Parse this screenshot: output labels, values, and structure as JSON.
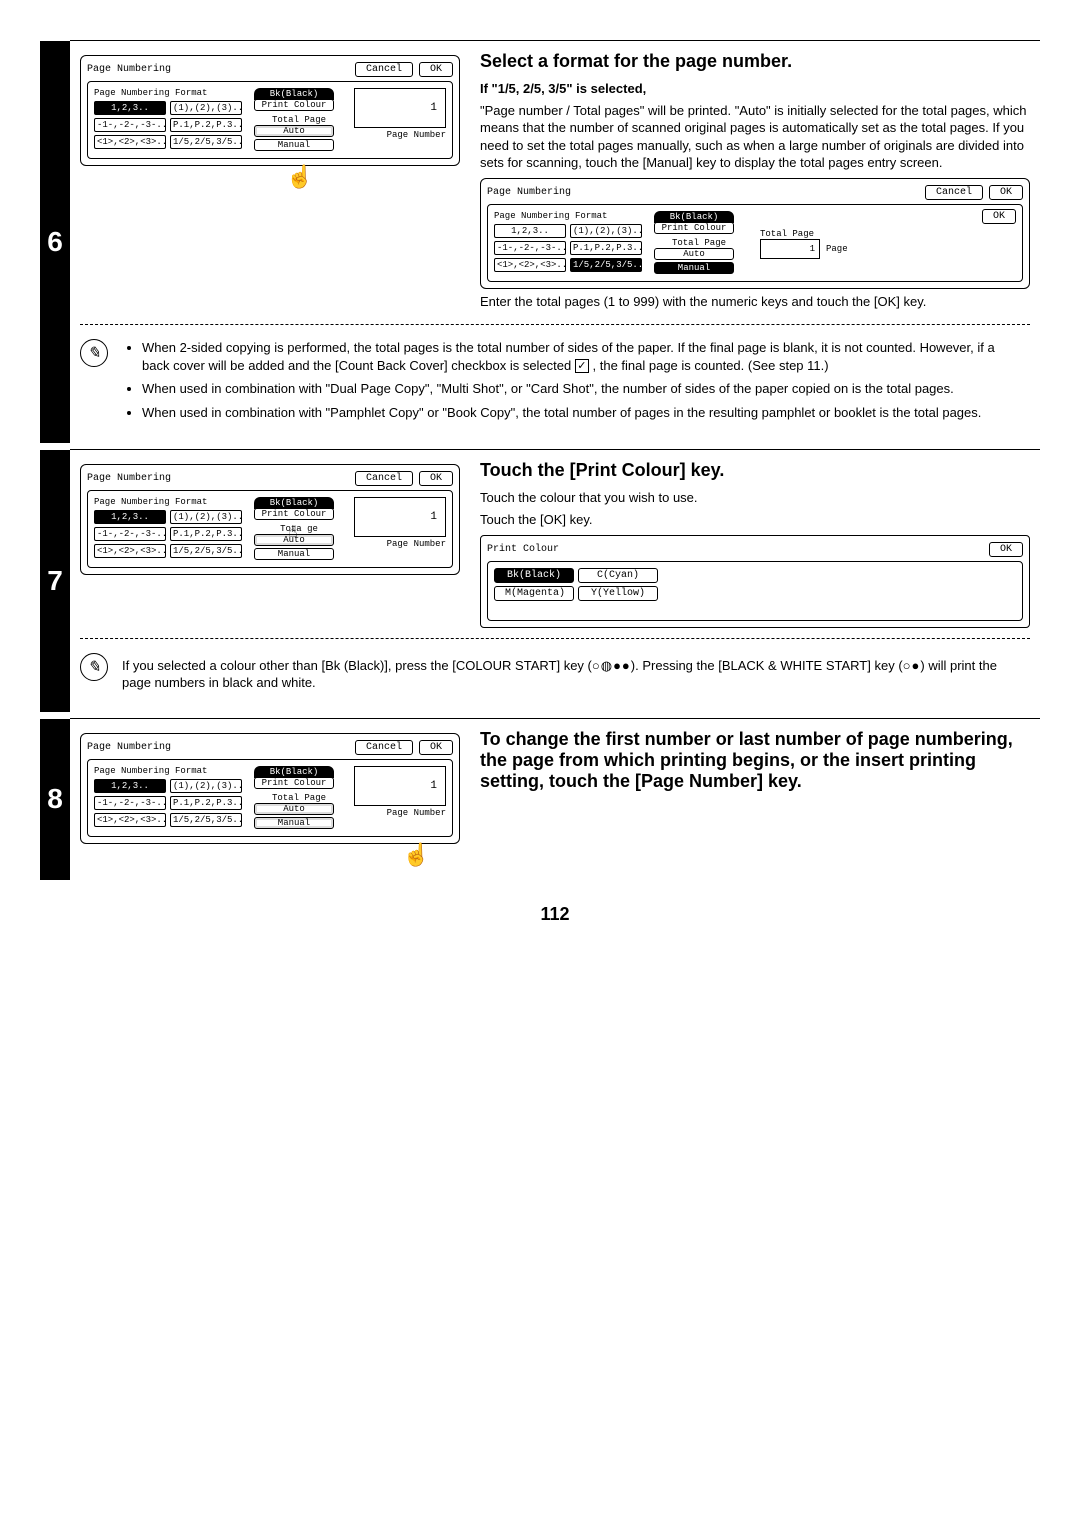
{
  "page_number": "112",
  "step6": {
    "num": "6",
    "title": "Select a format for the page number.",
    "sub_bold": "If \"1/5, 2/5, 3/5\" is selected,",
    "para1": "\"Page number / Total pages\" will be printed. \"Auto\" is initially selected for the total pages, which means that the number of scanned original pages is automatically set as the total pages. If you need to set the total pages manually, such as when a large number of originals are divided into sets for scanning, touch the [Manual] key to display the total pages entry screen.",
    "para2": "Enter the total pages (1 to 999) with the numeric keys and touch the [OK] key.",
    "panel": {
      "title": "Page Numbering",
      "cancel": "Cancel",
      "ok": "OK",
      "format_label": "Page Numbering Format",
      "formats": [
        "1,2,3..",
        "(1),(2),(3)..",
        "-1-,-2-,-3-..",
        "P.1,P.2,P.3..",
        "<1>,<2>,<3>..",
        "1/5,2/5,3/5.."
      ],
      "bk": "Bk(Black)",
      "print_colour": "Print Colour",
      "total_page": "Total Page",
      "auto": "Auto",
      "manual": "Manual",
      "value": "1",
      "page_number_label": "Page Number"
    },
    "panel2": {
      "total_page_label": "Total Page",
      "page_label": "Page",
      "value": "1"
    },
    "notes": [
      "When 2-sided copying is performed, the total pages is the total number of sides of the paper. If the final page is blank, it is not counted. However, if a back cover will be added and the [Count Back Cover] checkbox is selected",
      ", the final page is counted. (See step 11.)",
      "When used in combination with \"Dual Page Copy\", \"Multi Shot\", or \"Card Shot\", the number of sides of the paper copied on is the total pages.",
      "When used in combination with \"Pamphlet Copy\" or \"Book Copy\", the total number of pages in the resulting pamphlet or booklet is the total pages."
    ]
  },
  "step7": {
    "num": "7",
    "title": "Touch the [Print Colour] key.",
    "para1": "Touch the colour that you wish to use.",
    "para2": "Touch the [OK] key.",
    "colour_panel": {
      "title": "Print Colour",
      "ok": "OK",
      "bk": "Bk(Black)",
      "c": "C(Cyan)",
      "m": "M(Magenta)",
      "y": "Y(Yellow)"
    },
    "note": "If you selected a colour other than [Bk (Black)], press the [COLOUR START] key (",
    "note_tail": "). Pressing the [BLACK & WHITE START] key (",
    "note_tail2": ") will print the page numbers in black and white."
  },
  "step8": {
    "num": "8",
    "title": "To change the first number or last number of page numbering, the page from which printing begins, or the insert printing setting, touch the [Page Number] key."
  }
}
